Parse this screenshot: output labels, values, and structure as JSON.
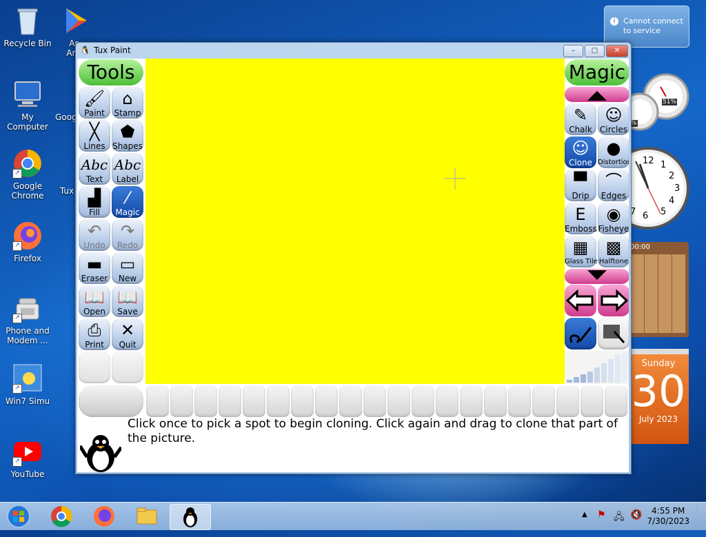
{
  "desktop": {
    "icons": [
      {
        "label": "Recycle Bin"
      },
      {
        "label": "My Computer"
      },
      {
        "label": "Google Chrome"
      },
      {
        "label": "Firefox"
      },
      {
        "label": "Phone and Modem ..."
      },
      {
        "label": "Win7 Simu"
      },
      {
        "label": "YouTube"
      },
      {
        "label": "Ap And"
      },
      {
        "label": "Goog"
      },
      {
        "label": "Tux"
      }
    ]
  },
  "notification": {
    "text": "Cannot connect to service"
  },
  "gadgets": {
    "meter_percent": "51%",
    "meter_small": "%",
    "puzzle_time": "00:00",
    "calendar": {
      "weekday": "Sunday",
      "day": "30",
      "month_year": "July 2023"
    },
    "clock_numbers": [
      "12",
      "1",
      "2",
      "3",
      "4",
      "5",
      "6",
      "7"
    ]
  },
  "window": {
    "title": "Tux Paint",
    "tools_header": "Tools",
    "magic_header": "Magic",
    "tools": [
      {
        "label": "Paint",
        "icon": "brush-icon",
        "glyph": "🖌"
      },
      {
        "label": "Stamp",
        "icon": "stamp-icon",
        "glyph": "⌂"
      },
      {
        "label": "Lines",
        "icon": "lines-icon",
        "glyph": "╳"
      },
      {
        "label": "Shapes",
        "icon": "pentagon-icon",
        "glyph": "⬟"
      },
      {
        "label": "Text",
        "icon": "text-icon",
        "glyph": "Abc"
      },
      {
        "label": "Label",
        "icon": "label-icon",
        "glyph": "Abc"
      },
      {
        "label": "Fill",
        "icon": "bucket-icon",
        "glyph": "▟"
      },
      {
        "label": "Magic",
        "icon": "magic-wand-icon",
        "glyph": "⁄"
      },
      {
        "label": "Undo",
        "icon": "undo-icon",
        "glyph": "↶"
      },
      {
        "label": "Redo",
        "icon": "redo-icon",
        "glyph": "↷"
      },
      {
        "label": "Eraser",
        "icon": "eraser-icon",
        "glyph": "▬"
      },
      {
        "label": "New",
        "icon": "new-page-icon",
        "glyph": "▭"
      },
      {
        "label": "Open",
        "icon": "open-book-icon",
        "glyph": "📖"
      },
      {
        "label": "Save",
        "icon": "save-book-icon",
        "glyph": "📖"
      },
      {
        "label": "Print",
        "icon": "printer-icon",
        "glyph": "⎙"
      },
      {
        "label": "Quit",
        "icon": "quit-icon",
        "glyph": "✕"
      }
    ],
    "magic": [
      {
        "label": "Chalk",
        "icon": "chalk-icon",
        "glyph": "✎"
      },
      {
        "label": "Circles",
        "icon": "circles-icon",
        "glyph": "☺"
      },
      {
        "label": "Clone",
        "icon": "clone-icon",
        "glyph": "☺"
      },
      {
        "label": "Distortion",
        "icon": "distortion-icon",
        "glyph": "●"
      },
      {
        "label": "Drip",
        "icon": "drip-icon",
        "glyph": "▀"
      },
      {
        "label": "Edges",
        "icon": "edges-icon",
        "glyph": "⌒"
      },
      {
        "label": "Emboss",
        "icon": "emboss-icon",
        "glyph": "E"
      },
      {
        "label": "Fisheye",
        "icon": "fisheye-icon",
        "glyph": "◉"
      },
      {
        "label": "Glass Tile",
        "icon": "glass-tile-icon",
        "glyph": "▦"
      },
      {
        "label": "Halftone",
        "icon": "halftone-icon",
        "glyph": "▩"
      }
    ],
    "message": "Click once to pick a spot to begin cloning. Click again and drag to clone that part of the picture."
  },
  "taskbar": {
    "time": "4:55 PM",
    "date": "7/30/2023"
  },
  "colors": {
    "canvas": "#ffff00",
    "accent": "#1349a8"
  }
}
